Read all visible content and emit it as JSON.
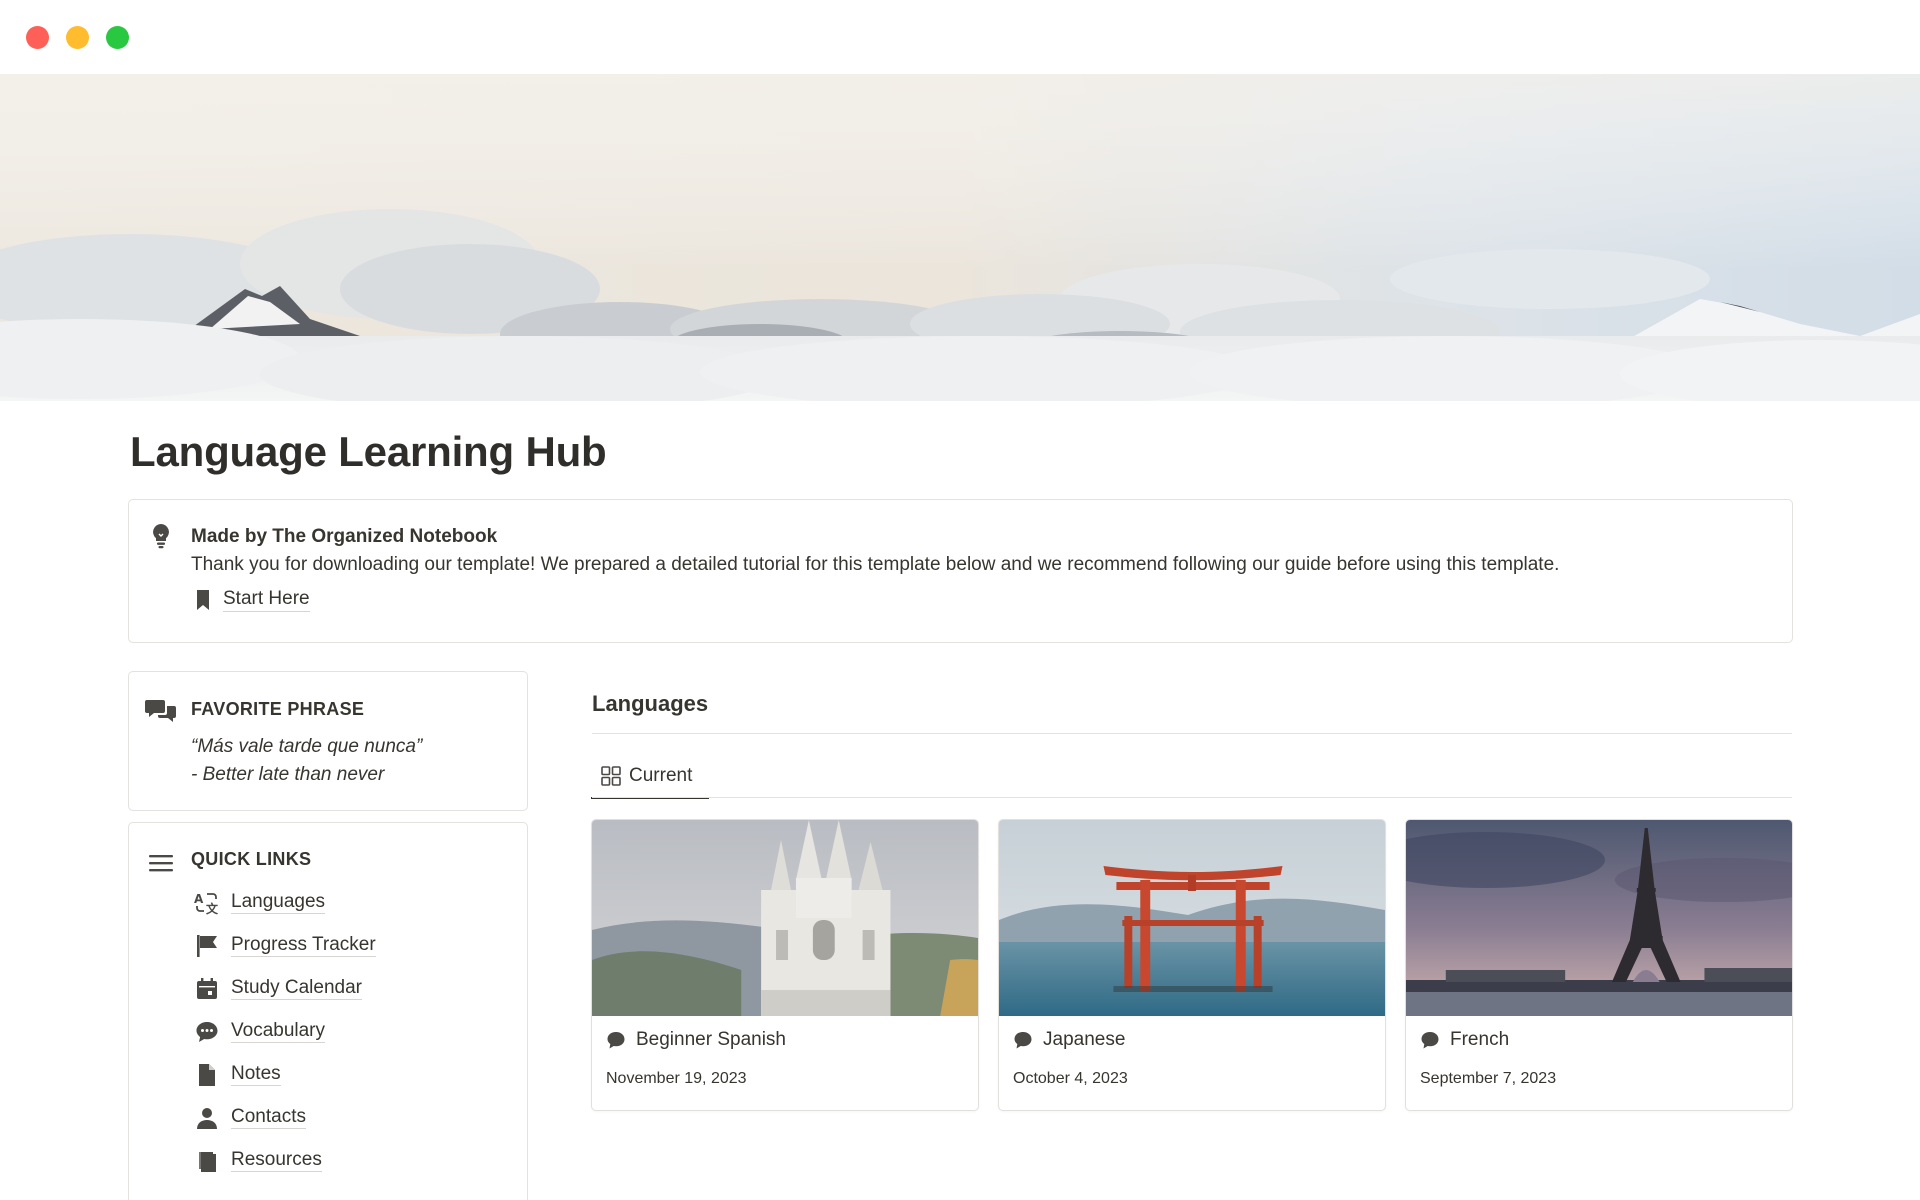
{
  "window": {
    "controls": [
      "close",
      "minimize",
      "zoom"
    ]
  },
  "page": {
    "title": "Language Learning Hub"
  },
  "callout": {
    "icon": "lightbulb-icon",
    "title": "Made by The Organized Notebook",
    "text": "Thank you for downloading our template! We prepared a detailed tutorial for this template below and we recommend following our guide before using this template.",
    "link_icon": "bookmark-icon",
    "link_label": "Start Here"
  },
  "favorite": {
    "icon": "chat-bubbles-icon",
    "title": "FAVORITE PHRASE",
    "line1": "“Más vale tarde que nunca”",
    "line2": "- Better late than never"
  },
  "quick_links": {
    "icon": "menu-icon",
    "title": "QUICK LINKS",
    "items": [
      {
        "label": "Languages",
        "icon": "translate-icon"
      },
      {
        "label": "Progress Tracker",
        "icon": "flag-icon"
      },
      {
        "label": "Study Calendar",
        "icon": "calendar-icon"
      },
      {
        "label": "Vocabulary",
        "icon": "speech-bubble-icon"
      },
      {
        "label": "Notes",
        "icon": "document-icon"
      },
      {
        "label": "Contacts",
        "icon": "person-icon"
      },
      {
        "label": "Resources",
        "icon": "book-icon"
      }
    ]
  },
  "languages": {
    "title": "Languages",
    "tab_label": "Current",
    "tab_icon": "gallery-icon",
    "cards": [
      {
        "name": "Beginner Spanish",
        "date": "November 19, 2023",
        "image": "cathedral-photo"
      },
      {
        "name": "Japanese",
        "date": "October 4, 2023",
        "image": "torii-gate-photo"
      },
      {
        "name": "French",
        "date": "September 7, 2023",
        "image": "eiffel-tower-photo"
      }
    ]
  }
}
